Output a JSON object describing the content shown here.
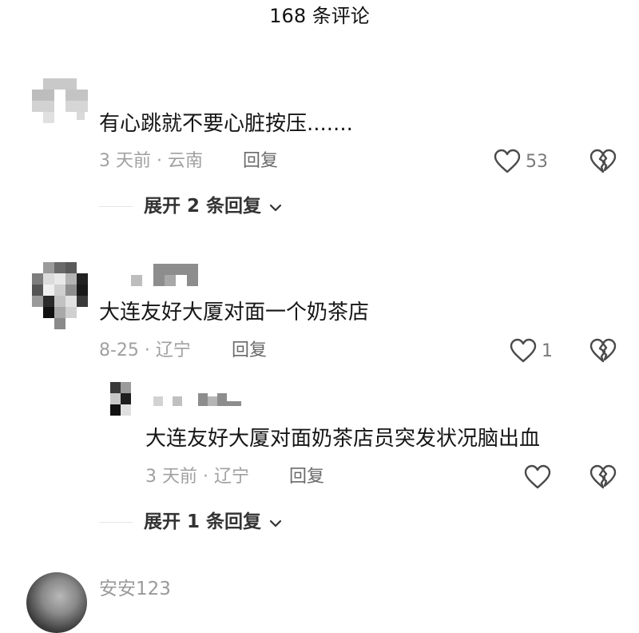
{
  "header": {
    "title": "168 条评论"
  },
  "comments": [
    {
      "text": "有心跳就不要心脏按压.......",
      "meta": "3 天前 · 云南",
      "reply_label": "回复",
      "likes": "53",
      "expand_label": "展开 2 条回复"
    },
    {
      "text": "大连友好大厦对面一个奶茶店",
      "meta": "8-25 · 辽宁",
      "reply_label": "回复",
      "likes": "1",
      "replies": [
        {
          "text": "大连友好大厦对面奶茶店员突发状况脑出血",
          "meta": "3 天前 · 辽宁",
          "reply_label": "回复"
        }
      ],
      "expand_label": "展开 1 条回复"
    },
    {
      "username": "安安123"
    }
  ],
  "icons": {
    "like": "heart-outline-icon",
    "dislike": "broken-heart-icon",
    "expand": "chevron-down-icon"
  }
}
